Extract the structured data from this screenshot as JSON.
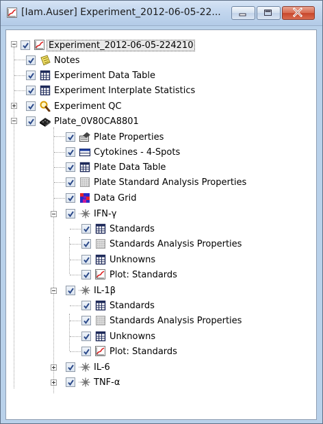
{
  "window": {
    "title": "[Iam.Auser] Experiment_2012-06-05-22...",
    "minimize_icon": "minimize-icon",
    "maximize_icon": "maximize-icon",
    "close_icon": "close-icon"
  },
  "tree": {
    "root": {
      "label": "Experiment_2012-06-05-224210",
      "icon": "plot-icon",
      "checked": true,
      "expanded": true
    },
    "notes": {
      "label": "Notes",
      "icon": "notes-icon"
    },
    "exp_table": {
      "label": "Experiment Data Table",
      "icon": "table-icon"
    },
    "exp_stats": {
      "label": "Experiment Interplate Statistics",
      "icon": "table-icon"
    },
    "exp_qc": {
      "label": "Experiment QC",
      "icon": "magnifier-icon",
      "expanded": false
    },
    "plate": {
      "label": "Plate_0V80CA8801",
      "icon": "plate-icon",
      "expanded": true
    },
    "plate_props": {
      "label": "Plate Properties",
      "icon": "plate-properties-icon"
    },
    "cytokines": {
      "label": "Cytokines - 4-Spots",
      "icon": "spots-icon"
    },
    "plate_table": {
      "label": "Plate Data Table",
      "icon": "table-icon"
    },
    "plate_std_props": {
      "label": "Plate Standard Analysis Properties",
      "icon": "grid-icon"
    },
    "data_grid": {
      "label": "Data Grid",
      "icon": "heatmap-icon"
    },
    "ifn": {
      "label": "IFN-γ",
      "icon": "analyte-icon",
      "expanded": true
    },
    "ifn_std": {
      "label": "Standards",
      "icon": "table-icon"
    },
    "ifn_std_props": {
      "label": "Standards Analysis Properties",
      "icon": "grid-icon"
    },
    "ifn_unk": {
      "label": "Unknowns",
      "icon": "table-icon"
    },
    "ifn_plot": {
      "label": "Plot: Standards",
      "icon": "plot-icon"
    },
    "il1b": {
      "label": "IL-1β",
      "icon": "analyte-icon",
      "expanded": true
    },
    "il1b_std": {
      "label": "Standards",
      "icon": "table-icon"
    },
    "il1b_std_props": {
      "label": "Standards Analysis Properties",
      "icon": "grid-icon"
    },
    "il1b_unk": {
      "label": "Unknowns",
      "icon": "table-icon"
    },
    "il1b_plot": {
      "label": "Plot: Standards",
      "icon": "plot-icon"
    },
    "il6": {
      "label": "IL-6",
      "icon": "analyte-icon",
      "expanded": false
    },
    "tnf": {
      "label": "TNF-α",
      "icon": "analyte-icon",
      "expanded": false
    }
  }
}
